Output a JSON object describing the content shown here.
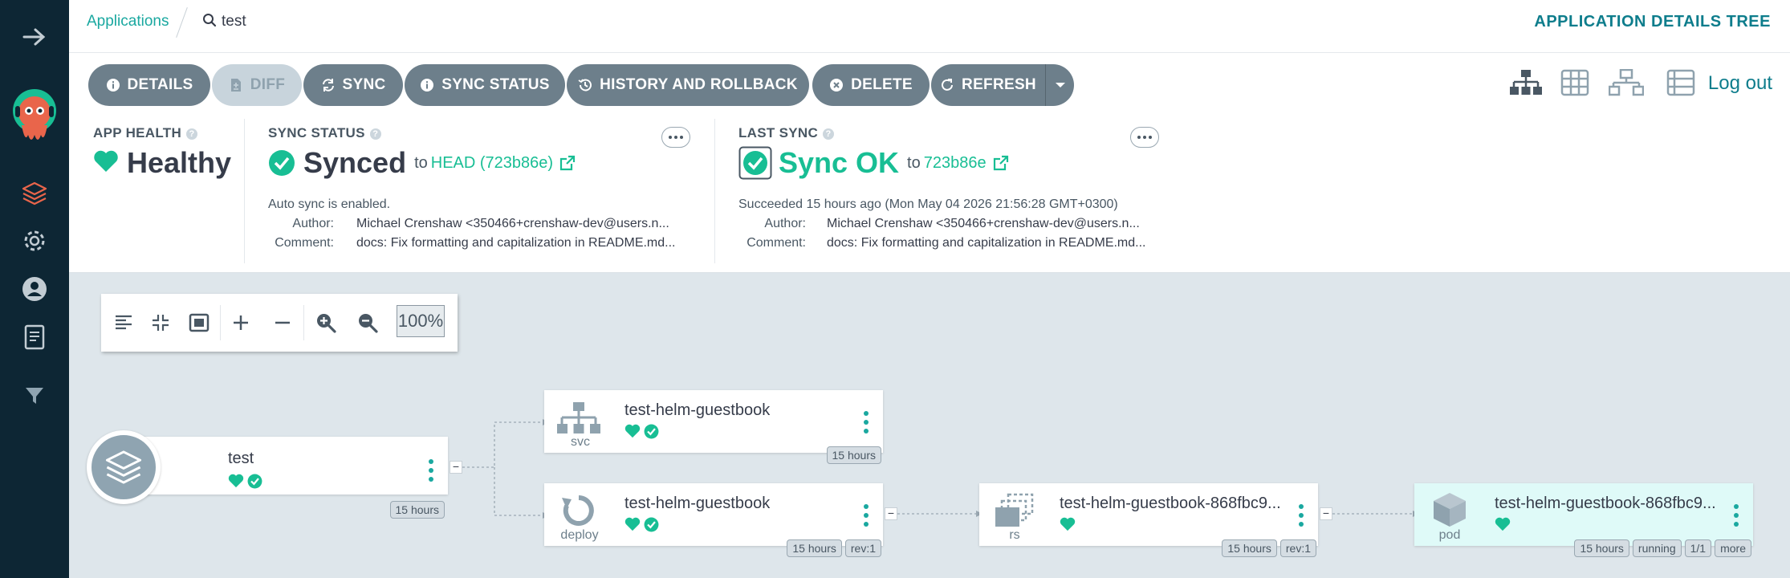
{
  "breadcrumb": {
    "root": "Applications",
    "search": "test"
  },
  "page_title": "APPLICATION DETAILS TREE",
  "toolbar": {
    "details": "DETAILS",
    "diff": "DIFF",
    "sync": "SYNC",
    "sync_status": "SYNC STATUS",
    "history": "HISTORY AND ROLLBACK",
    "delete": "DELETE",
    "refresh": "REFRESH",
    "logout": "Log out"
  },
  "app_health": {
    "label": "APP HEALTH",
    "value": "Healthy",
    "color": "#18be94"
  },
  "sync_status": {
    "label": "SYNC STATUS",
    "value": "Synced",
    "to": "to",
    "revision": "HEAD (723b86e)",
    "auto_sync": "Auto sync is enabled.",
    "author_key": "Author:",
    "author": "Michael Crenshaw <350466+crenshaw-dev@users.n...",
    "comment_key": "Comment:",
    "comment": "docs: Fix formatting and capitalization in README.md..."
  },
  "last_sync": {
    "label": "LAST SYNC",
    "value": "Sync OK",
    "to": "to",
    "revision": "723b86e",
    "succeeded": "Succeeded 15 hours ago (Mon May 04 2026 21:56:28 GMT+0300)",
    "author_key": "Author:",
    "author": "Michael Crenshaw <350466+crenshaw-dev@users.n...",
    "comment_key": "Comment:",
    "comment": "docs: Fix formatting and capitalization in README.md..."
  },
  "zoom": {
    "level": "100%"
  },
  "nodes": {
    "app": {
      "name": "test",
      "age": "15 hours"
    },
    "svc": {
      "name": "test-helm-guestbook",
      "kind": "svc",
      "age": "15 hours"
    },
    "deploy": {
      "name": "test-helm-guestbook",
      "kind": "deploy",
      "age": "15 hours",
      "rev": "rev:1"
    },
    "rs": {
      "name": "test-helm-guestbook-868fbc9...",
      "kind": "rs",
      "age": "15 hours",
      "rev": "rev:1"
    },
    "pod": {
      "name": "test-helm-guestbook-868fbc9...",
      "kind": "pod",
      "age": "15 hours",
      "status": "running",
      "ready": "1/1",
      "more": "more"
    }
  },
  "collapse_glyph": "−",
  "icons": [
    "arrow-right-icon",
    "argo-logo-icon",
    "layers-icon",
    "gear-icon",
    "user-icon",
    "docs-icon",
    "filter-icon",
    "search-icon",
    "info-icon",
    "file-diff-icon",
    "sync-icon",
    "history-icon",
    "delete-icon",
    "refresh-icon",
    "caret-down-icon",
    "tree-view-icon",
    "grid-view-icon",
    "network-view-icon",
    "list-view-icon",
    "heart-icon",
    "check-circle-icon",
    "external-link-icon"
  ]
}
